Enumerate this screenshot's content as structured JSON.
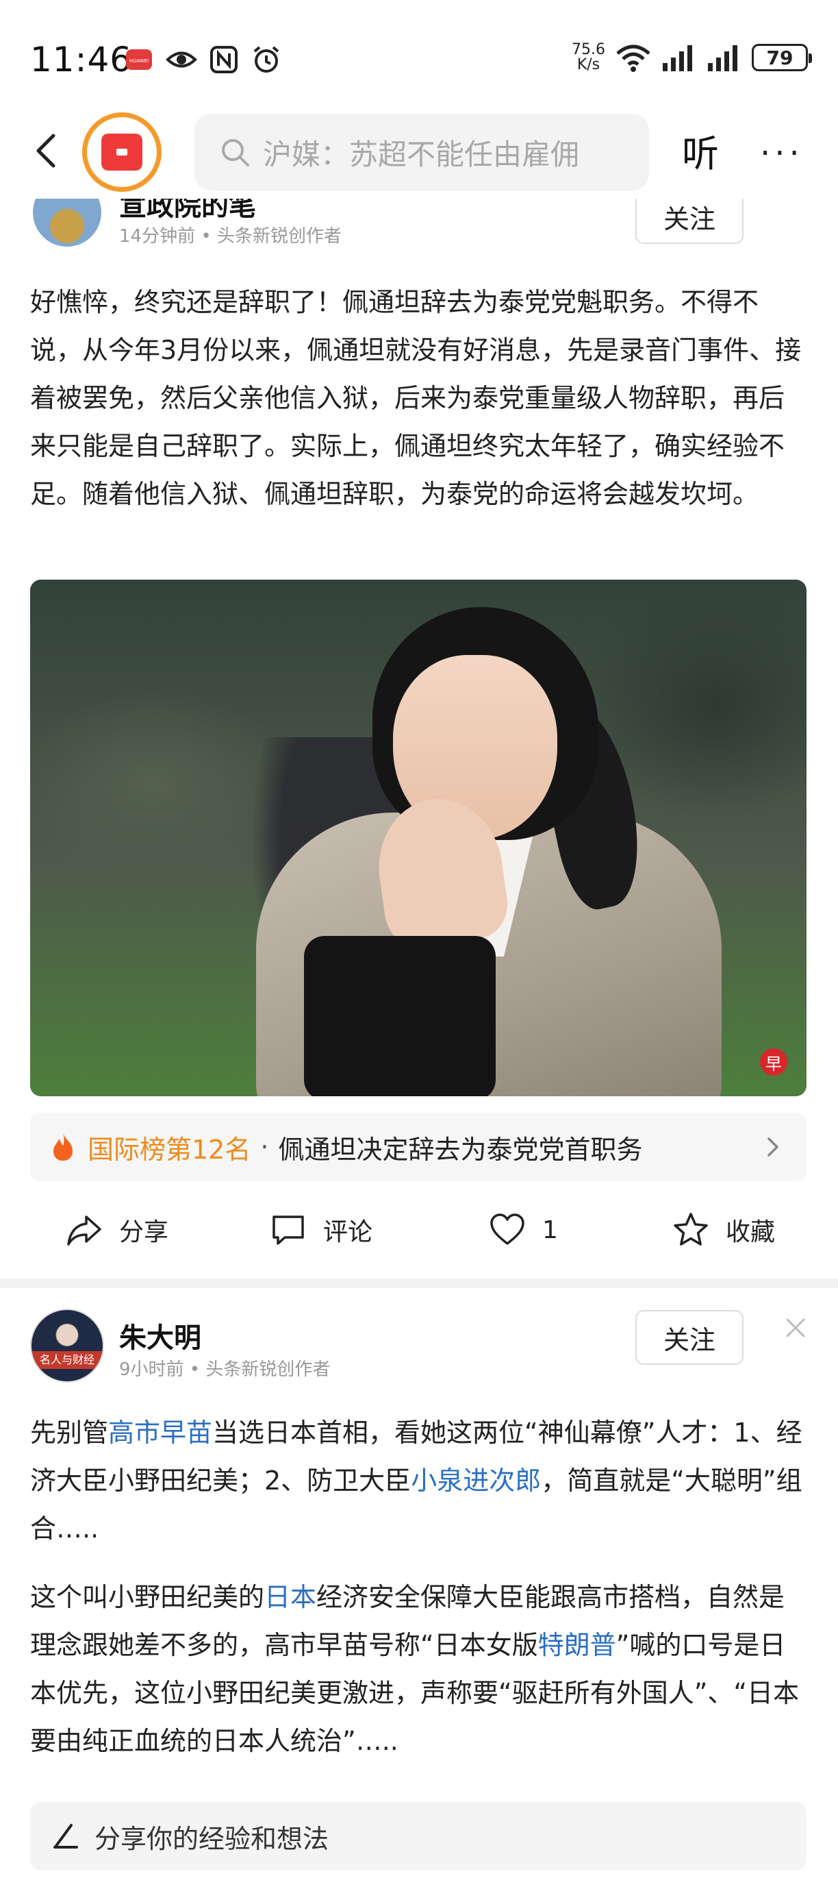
{
  "status_bar": {
    "time": "11:46",
    "network_speed_value": "75.6",
    "network_speed_unit": "K/s",
    "battery": "79",
    "huawei_badge": "HUAWEI"
  },
  "nav": {
    "search_placeholder": "沪媒：苏超不能任由雇佣",
    "listen_label": "听",
    "more_label": "···"
  },
  "post1": {
    "author": "宣政院的笔",
    "meta": "14分钟前 • 头条新锐创作者",
    "follow_label": "关注",
    "text": "好憔悴，终究还是辞职了！佩通坦辞去为泰党党魁职务。不得不说，从今年3月份以来，佩通坦就没有好消息，先是录音门事件、接着被罢免，然后父亲他信入狱，后来为泰党重量级人物辞职，再后来只能是自己辞职了。实际上，佩通坦终究太年轻了，确实经验不足。随着他信入狱、佩通坦辞职，为泰党的命运将会越发坎坷。",
    "photo_watermark": "早",
    "rank_label": "国际榜第12名",
    "rank_separator": "·",
    "rank_title": "佩通坦决定辞去为泰党党首职务",
    "actions": {
      "share": "分享",
      "comment": "评论",
      "like_count": "1",
      "favorite": "收藏"
    }
  },
  "post2": {
    "author": "朱大明",
    "avatar_caption": "名人与财经",
    "meta": "9小时前 • 头条新锐创作者",
    "follow_label": "关注",
    "para1": {
      "t1": "先别管",
      "link1": "高市早苗",
      "t2": "当选日本首相，看她这两位“神仙幕僚”人才：1、经济大臣小野田纪美；2、防卫大臣",
      "link2": "小泉进次郎",
      "t3": "，简直就是“大聪明”组合….."
    },
    "para2": {
      "t1": "这个叫小野田纪美的",
      "link1": "日本",
      "t2": "经济安全保障大臣能跟高市搭档，自然是理念跟她差不多的，高市早苗号称“日本女版",
      "link2": "特朗普",
      "t3": "”喊的口号是日本优先，这位小野田纪美更激进，声称要“驱赶所有外国人”、“日本要由纯正血统的日本人统治”….."
    }
  },
  "comment_bar": {
    "placeholder": "分享你的经验和想法"
  },
  "colors": {
    "accent_orange": "#ef8a1a",
    "link_blue": "#2b6fc2",
    "logo_red": "#ef3a3a",
    "logo_ring": "#f59a2a"
  }
}
